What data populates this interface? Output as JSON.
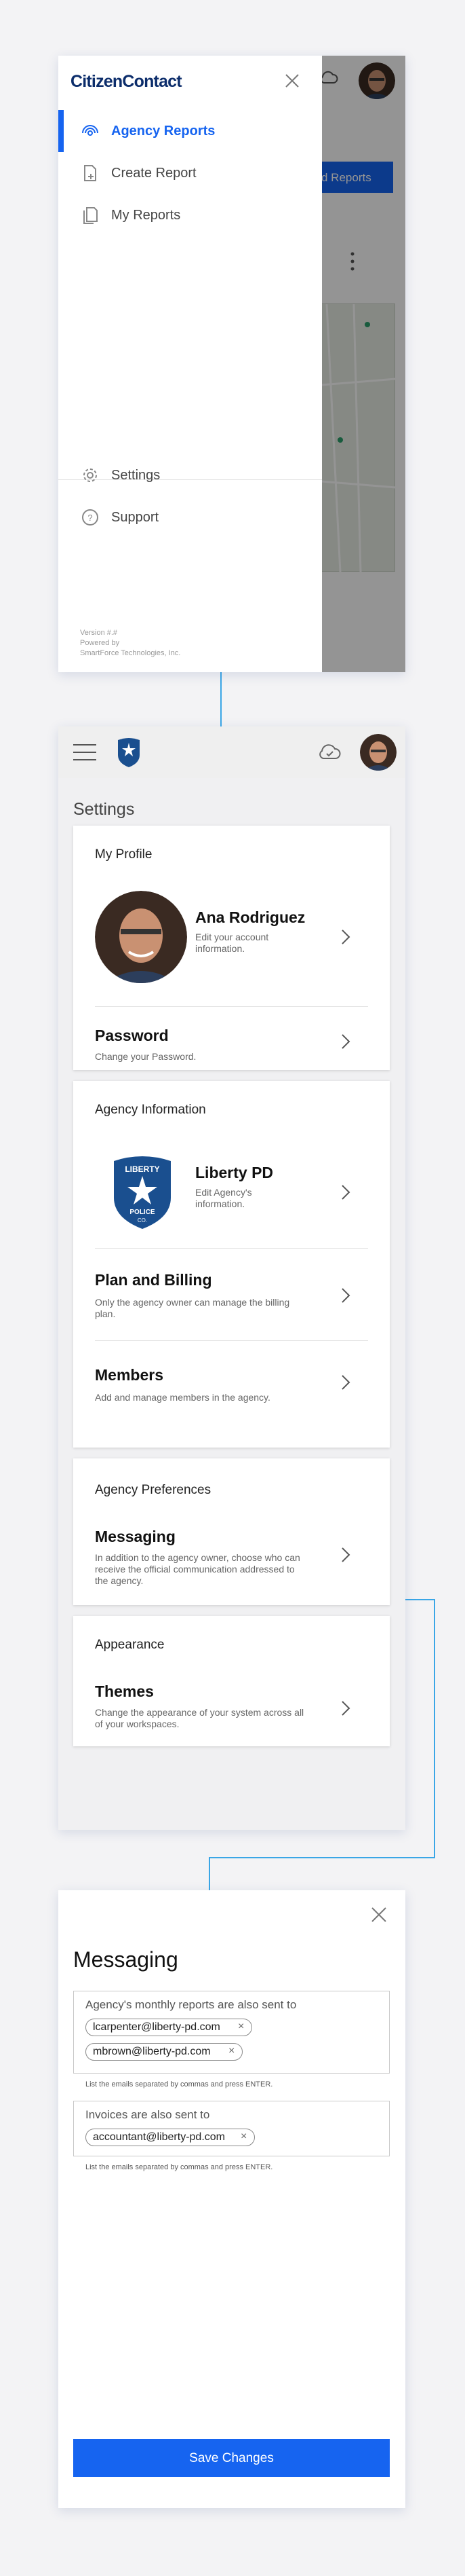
{
  "drawer": {
    "logo": "CitizenContact",
    "nav_items": [
      {
        "label": "Agency Reports",
        "icon": "agency-reports-icon",
        "active": true
      },
      {
        "label": "Create Report",
        "icon": "create-report-icon",
        "active": false
      },
      {
        "label": "My Reports",
        "icon": "my-reports-icon",
        "active": false
      }
    ],
    "settings_label": "Settings",
    "support_label": "Support",
    "version": "Version #.#",
    "powered_by": "Powered by",
    "company": "SmartForce Technologies, Inc.",
    "background_button": "d Reports"
  },
  "settings": {
    "page_title": "Settings",
    "profile": {
      "heading": "My Profile",
      "name": "Ana Rodriguez",
      "name_sub": "Edit your account information.",
      "password_title": "Password",
      "password_sub": "Change your Password."
    },
    "agency": {
      "heading": "Agency Information",
      "name": "Liberty PD",
      "name_sub": "Edit Agency's information.",
      "badge_top": "LIBERTY",
      "badge_mid": "POLICE",
      "badge_bot": "CO.",
      "billing_title": "Plan and Billing",
      "billing_sub": "Only the agency owner can manage the billing plan.",
      "members_title": "Members",
      "members_sub": "Add and manage members in the agency."
    },
    "preferences": {
      "heading": "Agency Preferences",
      "messaging_title": "Messaging",
      "messaging_sub": "In addition to the agency owner, choose who can receive the official communication addressed to the agency."
    },
    "appearance": {
      "heading": "Appearance",
      "themes_title": "Themes",
      "themes_sub": "Change the appearance of your system across all of your workspaces."
    }
  },
  "messaging": {
    "title": "Messaging",
    "reports_label": "Agency's monthly reports are also sent to",
    "report_emails": [
      "lcarpenter@liberty-pd.com",
      "mbrown@liberty-pd.com"
    ],
    "reports_hint": "List the emails separated by commas and press ENTER.",
    "invoices_label": "Invoices are also sent to",
    "invoice_emails": [
      "accountant@liberty-pd.com"
    ],
    "invoices_hint": "List the emails separated by commas and press ENTER.",
    "save_label": "Save Changes"
  },
  "colors": {
    "accent": "#1664f0",
    "brand": "#0c2d6b",
    "connector": "#3aa6e6"
  }
}
